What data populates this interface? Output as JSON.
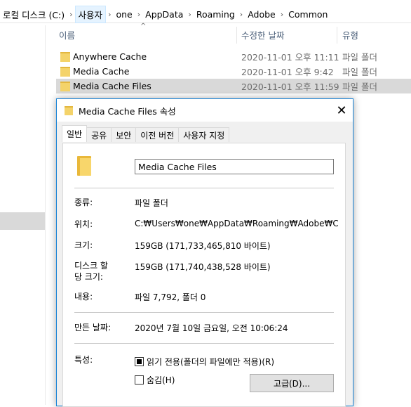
{
  "breadcrumb": [
    "로컬 디스크 (C:)",
    "사용자",
    "one",
    "AppData",
    "Roaming",
    "Adobe",
    "Common"
  ],
  "columns": {
    "name": "이름",
    "date": "수정한 날짜",
    "type": "유형"
  },
  "files": [
    {
      "name": "Anywhere Cache",
      "date": "2020-11-01 오후 11:11",
      "type": "파일 폴더"
    },
    {
      "name": "Media Cache",
      "date": "2020-11-01 오후 9:42",
      "type": "파일 폴더"
    },
    {
      "name": "Media Cache Files",
      "date": "2020-11-01 오후 11:59",
      "type": "파일 폴더"
    }
  ],
  "dialog": {
    "title": "Media Cache Files 속성",
    "close": "✕",
    "tabs": [
      "일반",
      "공유",
      "보안",
      "이전 버전",
      "사용자 지정"
    ],
    "name_value": "Media Cache Files",
    "labels": {
      "type": "종류:",
      "location": "위치:",
      "size": "크기:",
      "size_on_disk": "디스크 할\n당 크기:",
      "contains": "내용:",
      "created": "만든 날짜:",
      "attributes": "특성:"
    },
    "values": {
      "type": "파일 폴더",
      "location": "C:₩Users₩one₩AppData₩Roaming₩Adobe₩Common",
      "size": "159GB (171,733,465,810 바이트)",
      "size_on_disk": "159GB (171,740,438,528 바이트)",
      "contains": "파일 7,792, 폴더 0",
      "created": "2020년 7월 10일 금요일, 오전 10:06:24"
    },
    "readonly_label": "읽기 전용(폴더의 파일에만 적용)(R)",
    "hidden_label": "숨김(H)",
    "advanced_label": "고급(D)..."
  }
}
